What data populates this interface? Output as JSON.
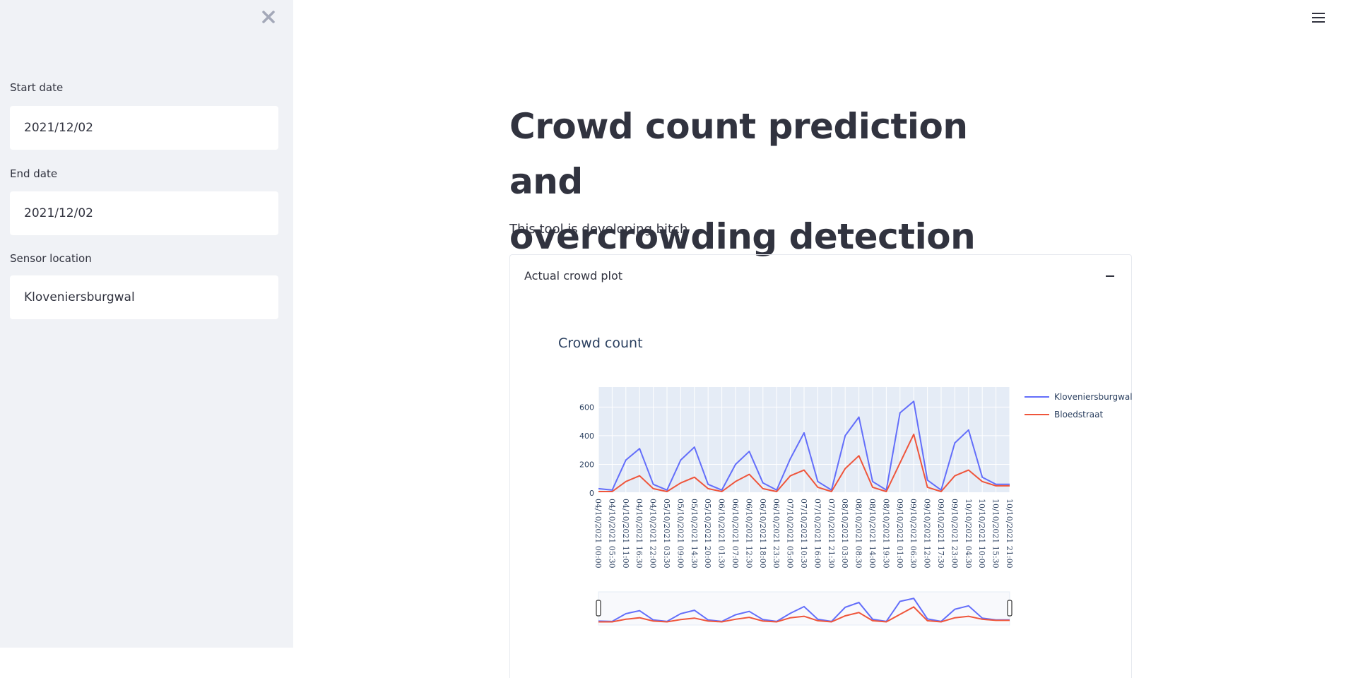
{
  "sidebar": {
    "close_icon": "close-icon",
    "start_date": {
      "label": "Start date",
      "value": "2021/12/02"
    },
    "end_date": {
      "label": "End date",
      "value": "2021/12/02"
    },
    "sensor_location": {
      "label": "Sensor location",
      "value": "Kloveniersburgwal"
    }
  },
  "header": {
    "menu_icon": "hamburger-menu-icon"
  },
  "main": {
    "title_line1": "Crowd count prediction and",
    "title_line2": "overcrowding detection",
    "subtitle": "This tool is developing bitch",
    "expander": {
      "label": "Actual crowd plot",
      "state_icon": "collapse-minus-icon"
    }
  },
  "colors": {
    "kloveniersburgwal": "#636efa",
    "bloedstraat": "#ef553b",
    "plot_bg": "#e5ecf6"
  },
  "chart_data": {
    "type": "line",
    "title": "Crowd count",
    "xlabel": "",
    "ylabel": "",
    "ylim": [
      0,
      740
    ],
    "yticks": [
      0,
      200,
      400,
      600
    ],
    "x_tick_labels": [
      "04/10/2021 00:00",
      "04/10/2021 05:30",
      "04/10/2021 11:00",
      "04/10/2021 16:30",
      "04/10/2021 22:00",
      "05/10/2021 03:30",
      "05/10/2021 09:00",
      "05/10/2021 14:30",
      "05/10/2021 20:00",
      "06/10/2021 01:30",
      "06/10/2021 07:00",
      "06/10/2021 12:30",
      "06/10/2021 18:00",
      "06/10/2021 23:30",
      "07/10/2021 05:00",
      "07/10/2021 10:30",
      "07/10/2021 16:00",
      "07/10/2021 21:30",
      "08/10/2021 03:00",
      "08/10/2021 08:30",
      "08/10/2021 14:00",
      "08/10/2021 19:30",
      "09/10/2021 01:00",
      "09/10/2021 06:30",
      "09/10/2021 12:00",
      "09/10/2021 17:30",
      "09/10/2021 23:00",
      "10/10/2021 04:30",
      "10/10/2021 10:00",
      "10/10/2021 15:30",
      "10/10/2021 21:00"
    ],
    "x": [
      "04/10/2021 00:00",
      "04/10/2021 05:30",
      "04/10/2021 11:00",
      "04/10/2021 16:30",
      "04/10/2021 22:00",
      "05/10/2021 03:30",
      "05/10/2021 09:00",
      "05/10/2021 14:30",
      "05/10/2021 20:00",
      "06/10/2021 01:30",
      "06/10/2021 07:00",
      "06/10/2021 12:30",
      "06/10/2021 18:00",
      "06/10/2021 23:30",
      "07/10/2021 05:00",
      "07/10/2021 10:30",
      "07/10/2021 16:00",
      "07/10/2021 21:30",
      "08/10/2021 03:00",
      "08/10/2021 08:30",
      "08/10/2021 14:00",
      "08/10/2021 19:30",
      "09/10/2021 01:00",
      "09/10/2021 06:30",
      "09/10/2021 12:00",
      "09/10/2021 17:30",
      "09/10/2021 23:00",
      "10/10/2021 04:30",
      "10/10/2021 10:00",
      "10/10/2021 15:30",
      "10/10/2021 21:00"
    ],
    "series": [
      {
        "name": "Kloveniersburgwal",
        "color": "#636efa",
        "values": [
          30,
          20,
          230,
          310,
          60,
          20,
          230,
          320,
          60,
          20,
          200,
          290,
          70,
          20,
          240,
          420,
          80,
          20,
          400,
          530,
          80,
          20,
          560,
          640,
          90,
          20,
          350,
          440,
          110,
          60,
          60
        ]
      },
      {
        "name": "Bloedstraat",
        "color": "#ef553b",
        "values": [
          10,
          10,
          80,
          120,
          30,
          10,
          70,
          110,
          30,
          10,
          80,
          130,
          30,
          10,
          120,
          160,
          40,
          10,
          170,
          260,
          40,
          10,
          210,
          410,
          40,
          10,
          120,
          160,
          80,
          50,
          50
        ]
      }
    ],
    "legend_position": "right",
    "grid": true,
    "rangeslider": true
  }
}
